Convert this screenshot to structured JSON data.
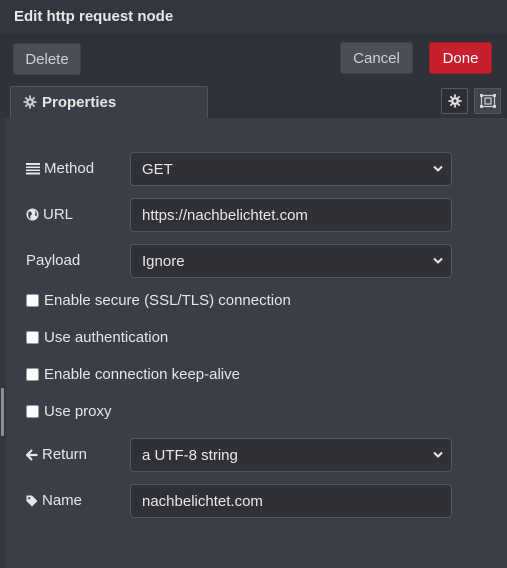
{
  "window": {
    "title": "Edit http request node"
  },
  "toolbar": {
    "delete_label": "Delete",
    "cancel_label": "Cancel",
    "done_label": "Done"
  },
  "tabs": {
    "properties_label": "Properties"
  },
  "form": {
    "method": {
      "label": "Method",
      "value": "GET"
    },
    "url": {
      "label": "URL",
      "value": "https://nachbelichtet.com"
    },
    "payload": {
      "label": "Payload",
      "value": "Ignore"
    },
    "ssl": {
      "label": "Enable secure (SSL/TLS) connection",
      "checked": false
    },
    "auth": {
      "label": "Use authentication",
      "checked": false
    },
    "keepalive": {
      "label": "Enable connection keep-alive",
      "checked": false
    },
    "proxy": {
      "label": "Use proxy",
      "checked": false
    },
    "return": {
      "label": "Return",
      "value": "a UTF-8 string"
    },
    "name": {
      "label": "Name",
      "value": "nachbelichtet.com"
    }
  },
  "colors": {
    "done": "#c61f2d",
    "panel": "#3b3e46",
    "header": "#33363d"
  }
}
